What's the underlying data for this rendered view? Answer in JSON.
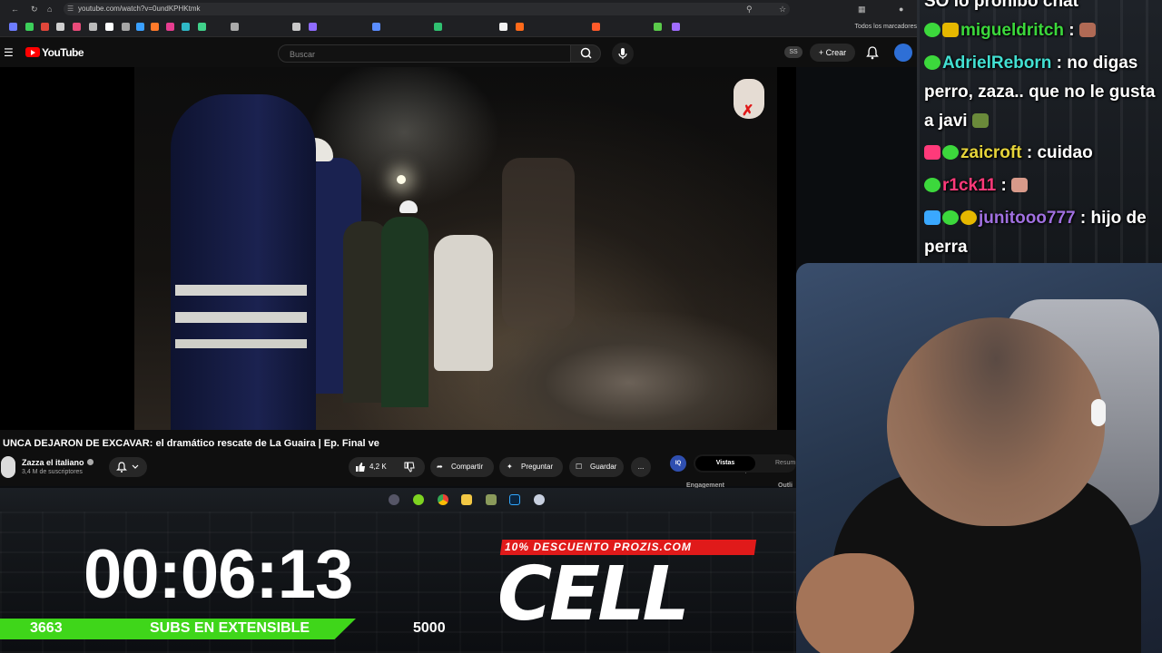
{
  "browser": {
    "url": "youtube.com/watch?v=0undKPHKtmk",
    "bookmarks_folder": "Todos los marcadores"
  },
  "youtube": {
    "logo": "YouTube",
    "search_placeholder": "Buscar",
    "badge": "SS",
    "create_label": "Crear"
  },
  "video": {
    "title": "UNCA DEJARON DE EXCAVAR: el dramático rescate de La Guaira | Ep. Final ve",
    "channel_name": "Zazza el italiano",
    "channel_subs": "3,4 M de suscriptores",
    "likes": "4,2 K",
    "share_label": "Compartir",
    "ask_label": "Preguntar",
    "save_label": "Guardar",
    "more_label": "...",
    "panel": {
      "icon": "IQ",
      "tab_active": "Vistas",
      "tab_other": "Resum",
      "label_engagement": "Engagement",
      "label_outline": "Outli"
    }
  },
  "overlay": {
    "timer": "00:06:13",
    "subs_current": "3663",
    "subs_label": "SUBS EN EXTENSIBLE",
    "subs_goal": "5000",
    "subs_progress_fraction": 0.73,
    "promo": "10% DESCUENTO PROZIS.COM",
    "brand": "CELL"
  },
  "chat": {
    "messages": [
      {
        "user": "",
        "text": "SO lo prohibo chat"
      },
      {
        "user": "migueldritch",
        "user_color": "#3cd83c",
        "text": " : "
      },
      {
        "user": "AdrielReborn",
        "user_color": "#42e0d2",
        "text": " : no digas perro, zaza.. que no le gusta a javi "
      },
      {
        "user": "zaicroft",
        "user_color": "#e6d43a",
        "text": " : cuidao"
      },
      {
        "user": "r1ck11",
        "user_color": "#ff3a7a",
        "text": " : "
      },
      {
        "user": "junitooo777",
        "user_color": "#a070e0",
        "text": " : hijo de perra"
      }
    ]
  },
  "colors": {
    "youtube_red": "#ff0000",
    "progress_green": "#3fd61a",
    "promo_red": "#e01a1a"
  }
}
